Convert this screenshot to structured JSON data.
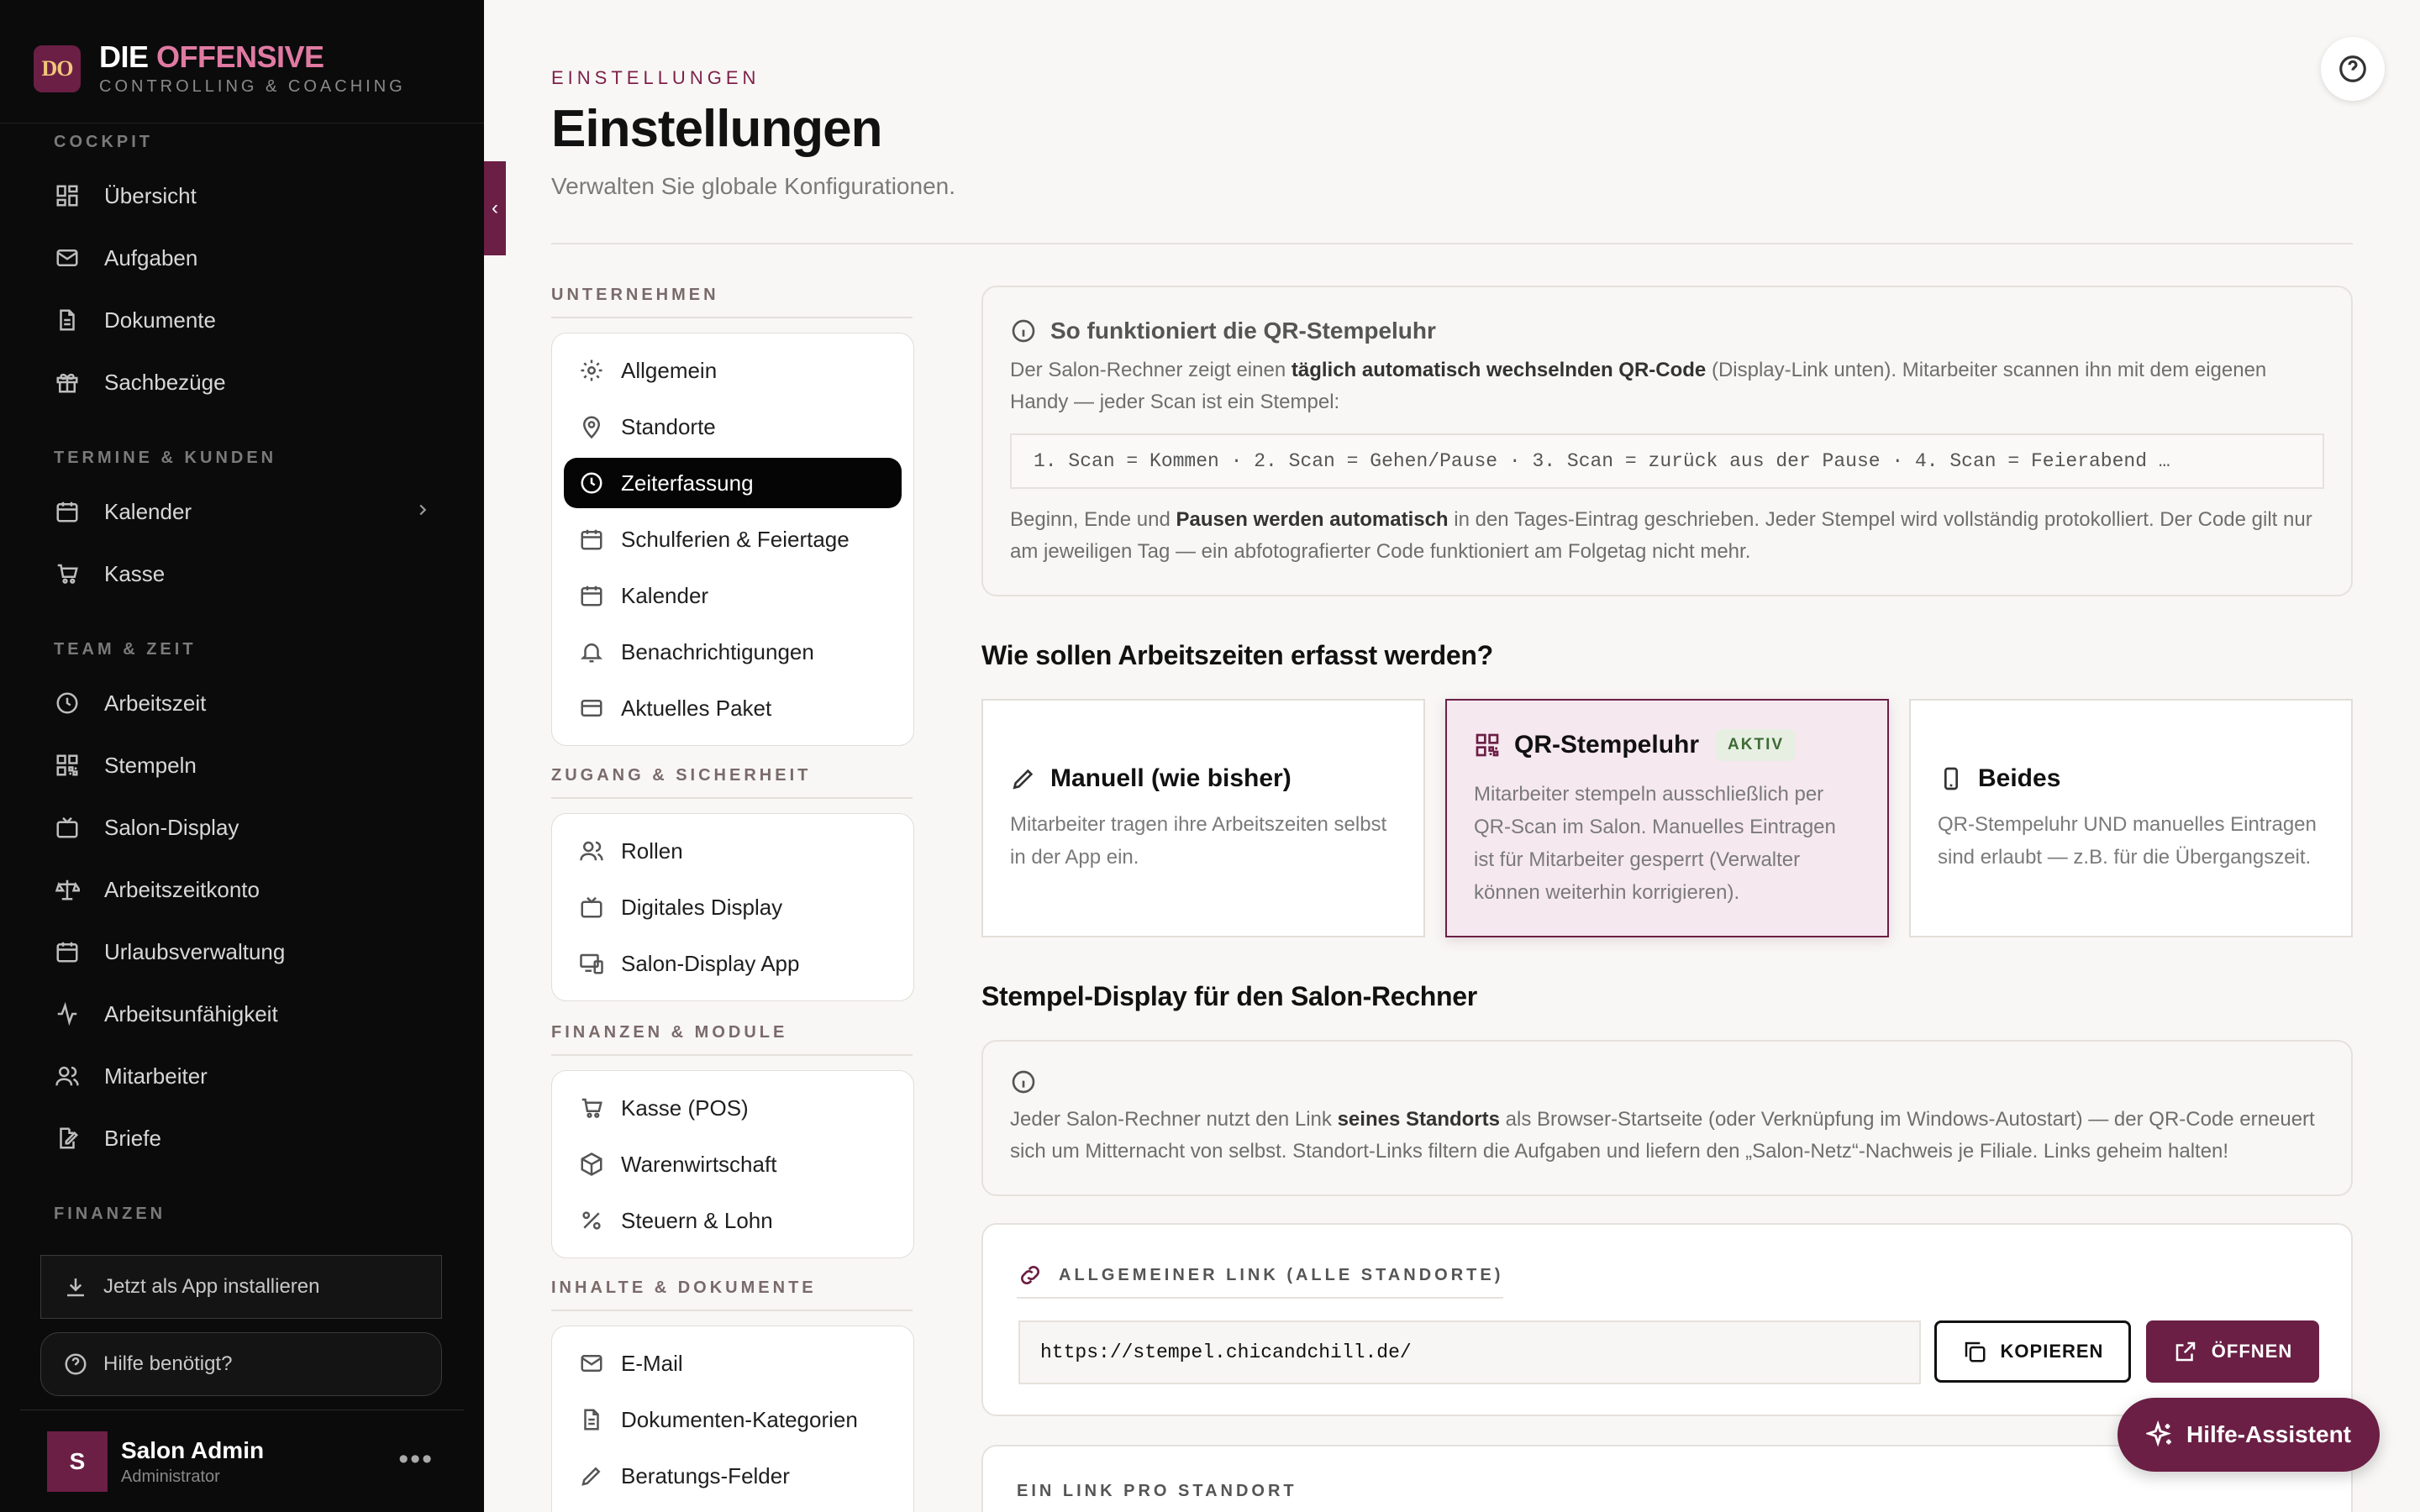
{
  "brand": {
    "logo": "DO",
    "name_part1": "DIE",
    "name_part2": "OFFENSIVE",
    "subtitle": "CONTROLLING & COACHING"
  },
  "sidebar": {
    "sections": [
      {
        "label": "COCKPIT"
      },
      {
        "label": "TERMINE & KUNDEN"
      },
      {
        "label": "TEAM & ZEIT"
      },
      {
        "label": "FINANZEN"
      }
    ],
    "items": [
      {
        "label": "Übersicht",
        "icon": "dashboard-icon"
      },
      {
        "label": "Aufgaben",
        "icon": "mail-icon"
      },
      {
        "label": "Dokumente",
        "icon": "document-icon"
      },
      {
        "label": "Sachbezüge",
        "icon": "gift-icon"
      },
      {
        "label": "Kalender",
        "icon": "calendar-icon"
      },
      {
        "label": "Kasse",
        "icon": "cart-icon"
      },
      {
        "label": "Arbeitszeit",
        "icon": "clock-icon"
      },
      {
        "label": "Stempeln",
        "icon": "qr-icon"
      },
      {
        "label": "Salon-Display",
        "icon": "tv-icon"
      },
      {
        "label": "Arbeitszeitkonto",
        "icon": "scale-icon"
      },
      {
        "label": "Urlaubsverwaltung",
        "icon": "calendar-icon"
      },
      {
        "label": "Arbeitsunfähigkeit",
        "icon": "activity-icon"
      },
      {
        "label": "Mitarbeiter",
        "icon": "users-icon"
      },
      {
        "label": "Briefe",
        "icon": "edit-document-icon"
      }
    ],
    "install_label": "Jetzt als App installieren",
    "help_label": "Hilfe benötigt?",
    "user": {
      "initial": "S",
      "name": "Salon Admin",
      "role": "Administrator",
      "more": "•••"
    }
  },
  "header": {
    "breadcrumb": "EINSTELLUNGEN",
    "title": "Einstellungen",
    "subtitle": "Verwalten Sie globale Konfigurationen."
  },
  "settings_nav": {
    "sections": [
      {
        "label": "UNTERNEHMEN"
      },
      {
        "label": "ZUGANG & SICHERHEIT"
      },
      {
        "label": "FINANZEN & MODULE"
      },
      {
        "label": "INHALTE & DOKUMENTE"
      }
    ],
    "items": [
      {
        "label": "Allgemein"
      },
      {
        "label": "Standorte"
      },
      {
        "label": "Zeiterfassung",
        "active": true
      },
      {
        "label": "Schulferien & Feiertage"
      },
      {
        "label": "Kalender"
      },
      {
        "label": "Benachrichtigungen"
      },
      {
        "label": "Aktuelles Paket"
      },
      {
        "label": "Rollen"
      },
      {
        "label": "Digitales Display"
      },
      {
        "label": "Salon-Display App"
      },
      {
        "label": "Kasse (POS)"
      },
      {
        "label": "Warenwirtschaft"
      },
      {
        "label": "Steuern & Lohn"
      },
      {
        "label": "E-Mail"
      },
      {
        "label": "Dokumenten-Kategorien"
      },
      {
        "label": "Beratungs-Felder"
      }
    ]
  },
  "info": {
    "title": "So funktioniert die QR-Stempeluhr",
    "p1_a": "Der Salon-Rechner zeigt einen ",
    "p1_b": "täglich automatisch wechselnden QR-Code",
    "p1_c": " (Display-Link unten). Mitarbeiter scannen ihn mit dem eigenen Handy — jeder Scan ist ein Stempel:",
    "code": "1. Scan = Kommen · 2. Scan = Gehen/Pause · 3. Scan = zurück aus der Pause · 4. Scan = Feierabend …",
    "p2_a": "Beginn, Ende und ",
    "p2_b": "Pausen werden automatisch",
    "p2_c": " in den Tages-Eintrag geschrieben. Jeder Stempel wird vollständig protokolliert. Der Code gilt nur am jeweiligen Tag — ein abfotografierter Code funktioniert am Folgetag nicht mehr."
  },
  "mode": {
    "heading": "Wie sollen Arbeitszeiten erfasst werden?",
    "options": [
      {
        "title": "Manuell (wie bisher)",
        "desc": "Mitarbeiter tragen ihre Arbeitszeiten selbst in der App ein."
      },
      {
        "title": "QR-Stempeluhr",
        "badge": "AKTIV",
        "desc": "Mitarbeiter stempeln ausschließlich per QR-Scan im Salon. Manuelles Eintragen ist für Mitarbeiter gesperrt (Verwalter können weiterhin korrigieren)."
      },
      {
        "title": "Beides",
        "desc": "QR-Stempeluhr UND manuelles Eintragen sind erlaubt — z.B. für die Übergangszeit."
      }
    ]
  },
  "display": {
    "heading": "Stempel-Display für den Salon-Rechner",
    "p_a": "Jeder Salon-Rechner nutzt den Link ",
    "p_b": "seines Standorts",
    "p_c": " als Browser-Startseite (oder Verknüpfung im Windows-Autostart) — der QR-Code erneuert sich um Mitternacht von selbst. Standort-Links filtern die Aufgaben und liefern den „Salon-Netz“-Nachweis je Filiale. Links geheim halten!",
    "general_label": "ALLGEMEINER LINK (ALLE STANDORTE)",
    "general_url": "https://stempel.chicandchill.de/",
    "copy_label": "KOPIEREN",
    "open_label": "ÖFFNEN",
    "per_location_label": "EIN LINK PRO STANDORT"
  },
  "assistant_label": "Hilfe-Assistent",
  "colors": {
    "brand": "#6b1f45",
    "brand_accent": "#e07aa2",
    "active_bg": "#f6e8ef"
  }
}
